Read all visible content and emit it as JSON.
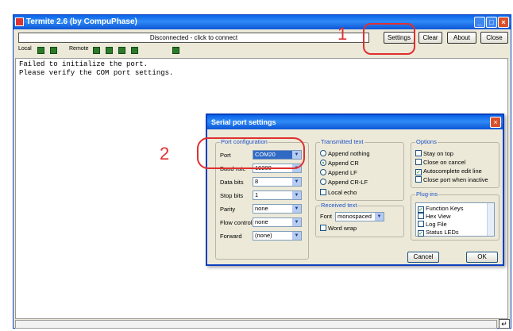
{
  "window": {
    "title": "Termite 2.6 (by CompuPhase)"
  },
  "toolbar": {
    "connect_status": "Disconnected - click to connect",
    "settings_label": "Settings",
    "clear_label": "Clear",
    "about_label": "About",
    "close_label": "Close"
  },
  "indicators": {
    "local_label": "Local",
    "remote_label": "Remote"
  },
  "terminal": {
    "lines": [
      "Failed to initialize the port.",
      "Please verify the COM port settings."
    ]
  },
  "annotations": {
    "step1": "1",
    "step2": "2"
  },
  "dialog": {
    "title": "Serial port settings",
    "port_config": {
      "heading": "Port configuration",
      "port_label": "Port",
      "port_value": "COM20",
      "baud_label": "Baud rate",
      "baud_value": "19200",
      "databits_label": "Data bits",
      "databits_value": "8",
      "stopbits_label": "Stop bits",
      "stopbits_value": "1",
      "parity_label": "Parity",
      "parity_value": "none",
      "flow_label": "Flow control",
      "flow_value": "none",
      "forward_label": "Forward",
      "forward_value": "(none)"
    },
    "transmitted": {
      "heading": "Transmitted text",
      "append_nothing": "Append nothing",
      "append_cr": "Append CR",
      "append_lf": "Append LF",
      "append_crlf": "Append CR-LF",
      "local_echo": "Local echo"
    },
    "received": {
      "heading": "Received text",
      "font_label": "Font",
      "font_value": "monospaced",
      "word_wrap": "Word wrap"
    },
    "options": {
      "heading": "Options",
      "stay_on_top": "Stay on top",
      "close_on_cancel": "Close on cancel",
      "autocomplete": "Autocomplete edit line",
      "close_inactive": "Close port when inactive"
    },
    "plugins": {
      "heading": "Plug-ins",
      "items": [
        "Function Keys",
        "Hex View",
        "Log File",
        "Status LEDs"
      ]
    },
    "cancel_label": "Cancel",
    "ok_label": "OK"
  }
}
